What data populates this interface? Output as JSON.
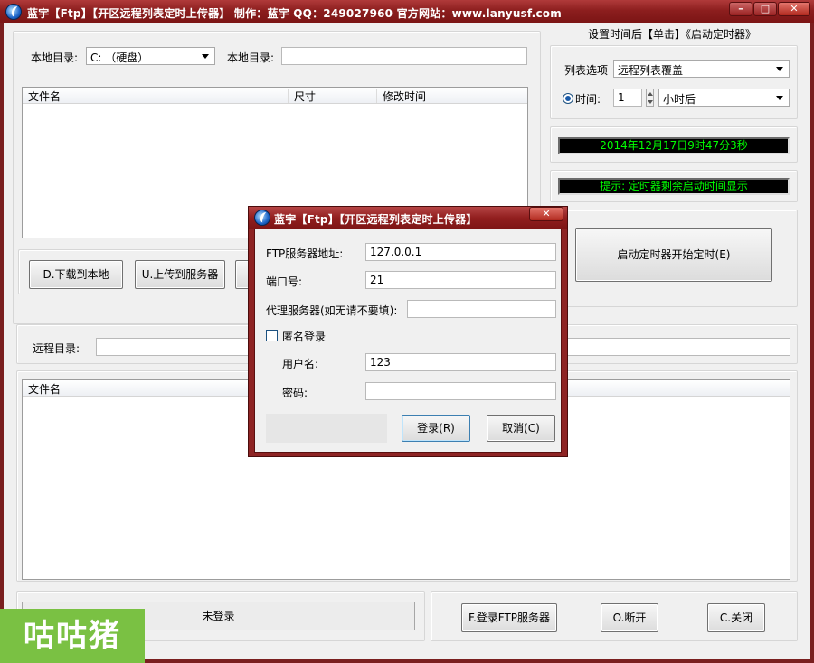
{
  "window": {
    "title": "蓝宇【Ftp】【开区远程列表定时上传器】 制作：蓝宇 QQ：249027960 官方网站：www.lanyusf.com",
    "min_label": "–",
    "max_label": "□",
    "close_label": "✕"
  },
  "local": {
    "dir_label": "本地目录:",
    "drive_value": "C: （硬盘）",
    "dir2_label": "本地目录:",
    "dir2_value": "",
    "columns": [
      "文件名",
      "尺寸",
      "修改时间"
    ],
    "download_btn": "D.下载到本地",
    "upload_btn": "U.上传到服务器"
  },
  "timer": {
    "header": "设置时间后【单击】《启动定时器》",
    "list_option_label": "列表选项",
    "list_option_value": "远程列表覆盖",
    "time_label": "时间:",
    "time_value": "1",
    "unit_value": "小时后",
    "datetime_display": "2014年12月17日9时47分3秒",
    "hint_display": "提示: 定时器剩余启动时间显示",
    "start_btn": "启动定时器开始定时(E)"
  },
  "remote": {
    "dir_label": "远程目录:",
    "dir_value": "",
    "columns": [
      "文件名"
    ]
  },
  "status": {
    "login_status": "未登录",
    "login_btn": "F.登录FTP服务器",
    "disconnect_btn": "O.断开",
    "close_btn": "C.关闭"
  },
  "dialog": {
    "title": "蓝宇【Ftp】【开区远程列表定时上传器】",
    "close_label": "✕",
    "server_label": "FTP服务器地址:",
    "server_value": "127.0.0.1",
    "port_label": "端口号:",
    "port_value": "21",
    "proxy_label": "代理服务器(如无请不要填):",
    "proxy_value": "",
    "anon_label": "匿名登录",
    "user_label": "用户名:",
    "user_value": "123",
    "pass_label": "密码:",
    "pass_value": "",
    "login_btn": "登录(R)",
    "cancel_btn": "取消(C)"
  },
  "watermark": {
    "text": "咕咕猪"
  },
  "colors": {
    "lcd_text": "#00ff00",
    "title_bar": "#8c1e1e",
    "watermark_bg": "#7ac143"
  }
}
